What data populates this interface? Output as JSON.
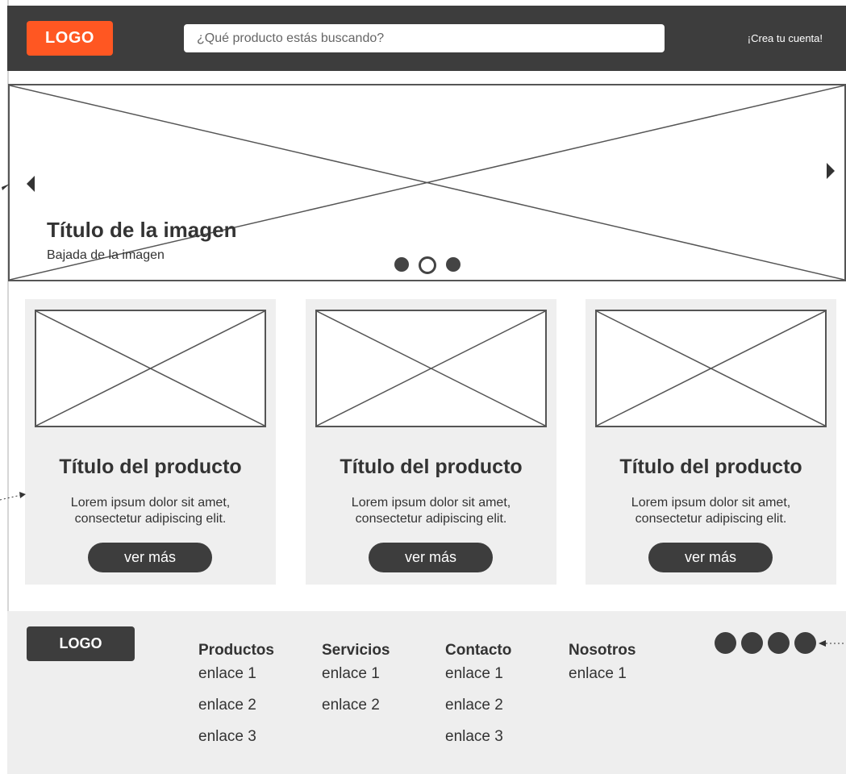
{
  "header": {
    "logo": "LOGO",
    "search_placeholder": "¿Qué producto estás buscando?",
    "create_account": "¡Crea tu cuenta!"
  },
  "hero": {
    "title": "Título de la imagen",
    "subtitle": "Bajada de la imagen",
    "slides_total": 3,
    "active_slide": 2
  },
  "products": [
    {
      "title": "Título del producto",
      "desc_line1": "Lorem ipsum dolor sit amet,",
      "desc_line2": "consectetur adipiscing elit.",
      "button": "ver más"
    },
    {
      "title": "Título del producto",
      "desc_line1": "Lorem ipsum dolor sit amet,",
      "desc_line2": "consectetur adipiscing elit.",
      "button": "ver más"
    },
    {
      "title": "Título del producto",
      "desc_line1": "Lorem ipsum dolor sit amet,",
      "desc_line2": "consectetur adipiscing elit.",
      "button": "ver más"
    }
  ],
  "footer": {
    "logo": "LOGO",
    "columns": [
      {
        "title": "Productos",
        "links": [
          "enlace 1",
          "enlace 2",
          "enlace 3"
        ]
      },
      {
        "title": "Servicios",
        "links": [
          "enlace 1",
          "enlace 2"
        ]
      },
      {
        "title": "Contacto",
        "links": [
          "enlace 1",
          "enlace 2",
          "enlace 3"
        ]
      },
      {
        "title": "Nosotros",
        "links": [
          "enlace 1"
        ]
      }
    ],
    "social_icons": [
      "social-icon",
      "social-icon",
      "social-icon",
      "social-icon"
    ]
  },
  "colors": {
    "brand": "#ff5722",
    "dark": "#3d3d3d",
    "card_bg": "#efefef",
    "footer_bg": "#eeeeee"
  }
}
